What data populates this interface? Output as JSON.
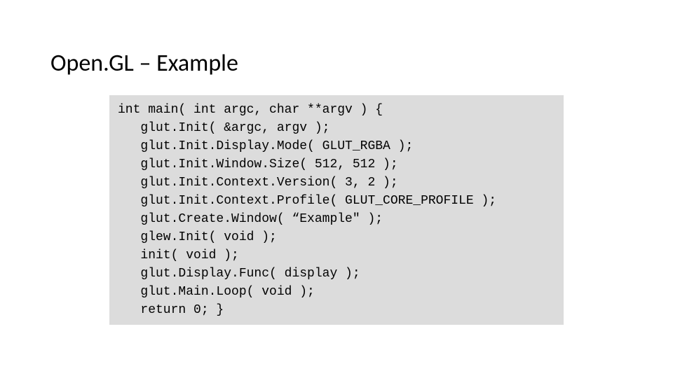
{
  "title": "Open.GL – Example",
  "code_lines": [
    "int main( int argc, char **argv ) {",
    "   glut.Init( &argc, argv );",
    "   glut.Init.Display.Mode( GLUT_RGBA );",
    "   glut.Init.Window.Size( 512, 512 );",
    "   glut.Init.Context.Version( 3, 2 );",
    "   glut.Init.Context.Profile( GLUT_CORE_PROFILE );",
    "   glut.Create.Window( “Example\" );",
    "   glew.Init( void );",
    "   init( void );",
    "   glut.Display.Func( display );",
    "   glut.Main.Loop( void );",
    "   return 0; }"
  ]
}
